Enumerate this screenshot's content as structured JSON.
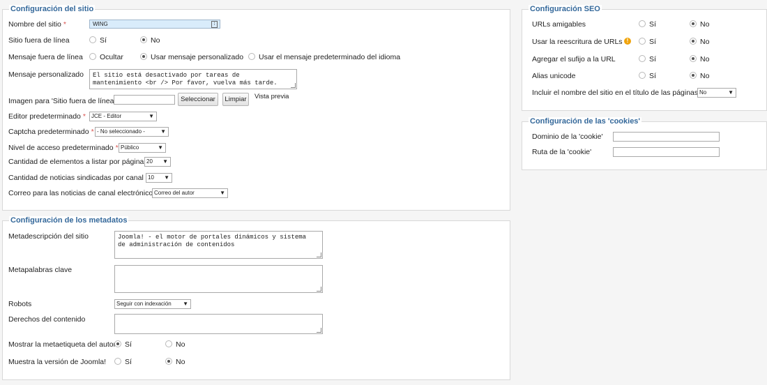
{
  "site": {
    "title": "Configuración del sitio",
    "site_name_label": "Nombre del sitio",
    "site_name_value": "WING",
    "offline_label": "Sitio fuera de línea",
    "offline_yes": "Sí",
    "offline_no": "No",
    "offline_msg_label": "Mensaje fuera de línea",
    "offline_msg_opt1": "Ocultar",
    "offline_msg_opt2": "Usar mensaje personalizado",
    "offline_msg_opt3": "Usar el mensaje predeterminado del idioma",
    "custom_msg_label": "Mensaje personalizado",
    "custom_msg_value": "El sitio está desactivado por tareas de\nmantenimiento <br /> Por favor, vuelva más tarde.",
    "offline_image_label": "Imagen para 'Sitio fuera de línea'",
    "select_button": "Seleccionar",
    "clear_button": "Limpiar",
    "preview_label": "Vista previa",
    "editor_label": "Editor predeterminado",
    "editor_value": "JCE - Editor",
    "captcha_label": "Captcha predeterminado",
    "captcha_value": "- No seleccionado -",
    "access_label": "Nivel de acceso predeterminado",
    "access_value": "Público",
    "list_limit_label": "Cantidad de elementos a listar por página",
    "list_limit_value": "20",
    "feed_limit_label": "Cantidad de noticias sindicadas por canal",
    "feed_limit_value": "10",
    "feed_email_label": "Correo para las noticias de canal electrónico",
    "feed_email_value": "Correo del autor"
  },
  "meta": {
    "title": "Configuración de los metadatos",
    "desc_label": "Metadescripción del sitio",
    "desc_value": "Joomla! - el motor de portales dinámicos y sistema\nde administración de contenidos",
    "keywords_label": "Metapalabras clave",
    "robots_label": "Robots",
    "robots_value": "Seguir con indexación",
    "rights_label": "Derechos del contenido",
    "author_label": "Mostrar la metaetiqueta del autor",
    "author_yes": "Sí",
    "author_no": "No",
    "version_label": "Muestra la versión de Joomla!",
    "version_yes": "Sí",
    "version_no": "No"
  },
  "seo": {
    "title": "Configuración SEO",
    "friendly_label": "URLs amigables",
    "rewrite_label": "Usar la reescritura de URLs",
    "suffix_label": "Agregar el sufijo a la URL",
    "unicode_label": "Alias unicode",
    "yes": "Sí",
    "no": "No",
    "sitename_label": "Incluir el nombre del sitio en el título de las páginas",
    "sitename_value": "No",
    "warning_glyph": "!"
  },
  "cookies": {
    "title": "Configuración de las 'cookies'",
    "domain_label": "Dominio de la 'cookie'",
    "path_label": "Ruta de la 'cookie'"
  },
  "colors": {
    "title_blue": "#34689a",
    "highlight_input": "#d9ecfb",
    "required_red": "#d9534f",
    "warning_orange": "#f0a30a"
  }
}
